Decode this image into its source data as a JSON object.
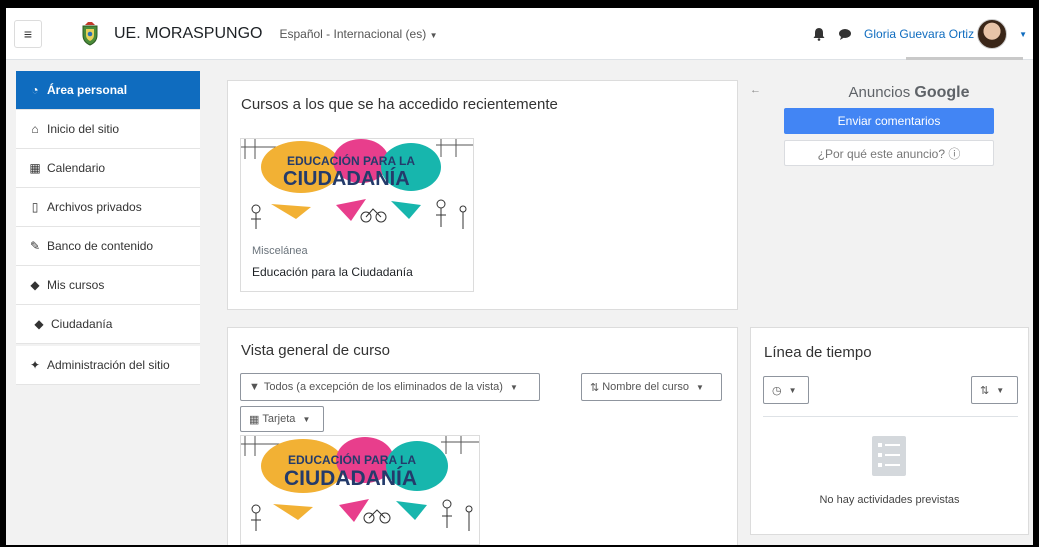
{
  "navbar": {
    "site_name": "UE. MORASPUNGO",
    "language": "Español - Internacional (es)",
    "user_name": "Gloria Guevara Ortiz",
    "icons": [
      "hamburger-icon",
      "school-logo-icon",
      "bell-icon",
      "chat-icon",
      "chevron-down-icon"
    ]
  },
  "sidebar": {
    "items": [
      {
        "label": "Área personal",
        "icon": "dashboard-icon"
      },
      {
        "label": "Inicio del sitio",
        "icon": "home-icon"
      },
      {
        "label": "Calendario",
        "icon": "calendar-icon"
      },
      {
        "label": "Archivos privados",
        "icon": "file-icon"
      },
      {
        "label": "Banco de contenido",
        "icon": "paintbrush-icon"
      },
      {
        "label": "Mis cursos",
        "icon": "graduation-cap-icon"
      },
      {
        "label": "Ciudadanía",
        "icon": "graduation-cap-icon"
      },
      {
        "label": "Administración del sitio",
        "icon": "wrench-icon"
      }
    ]
  },
  "recent": {
    "title": "Cursos a los que se ha accedido recientemente",
    "course": {
      "category": "Miscelánea",
      "name": "Educación para la Ciudadanía",
      "image_line1": "EDUCACIÓN PARA LA",
      "image_line2": "CIUDADANÍA"
    }
  },
  "ads": {
    "back": "←",
    "label": "Anuncios",
    "brand": "Google",
    "send_feedback": "Enviar comentarios",
    "why_ad": "¿Por qué este anuncio? ⓘ"
  },
  "overview": {
    "title": "Vista general de curso",
    "filter_label": "Todos (a excepción de los eliminados de la vista)",
    "sort_label": "Nombre del curso",
    "view_label": "Tarjeta",
    "course": {
      "image_line1": "EDUCACIÓN PARA LA",
      "image_line2": "CIUDADANÍA"
    }
  },
  "timeline": {
    "title": "Línea de tiempo",
    "empty_message": "No hay actividades previstas"
  },
  "colors": {
    "primary": "#0f6cbf",
    "google_blue": "#4285f4",
    "course_orange": "#f2b134",
    "course_pink": "#e83e8c",
    "course_teal": "#17b6ad",
    "course_navy": "#243b6b"
  }
}
